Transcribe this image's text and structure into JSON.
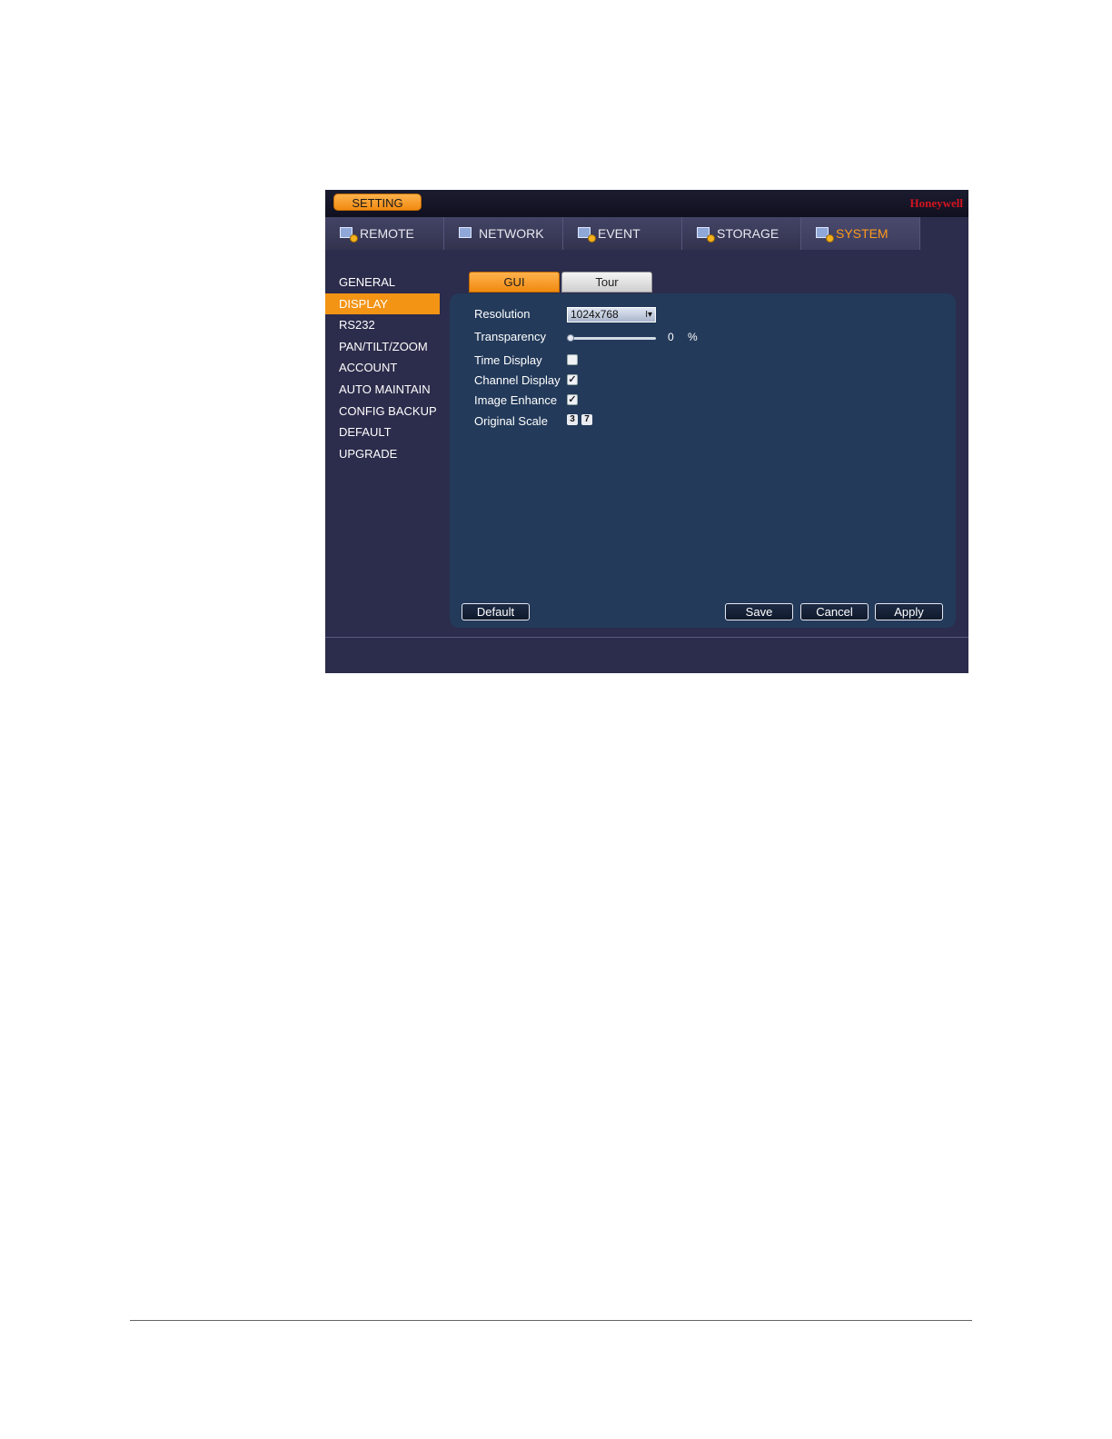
{
  "topbar": {
    "setting_label": "SETTING",
    "brand": "Honeywell"
  },
  "main_tabs": [
    {
      "label": "REMOTE",
      "icon": "remote-settings-icon"
    },
    {
      "label": "NETWORK",
      "icon": "network-icon"
    },
    {
      "label": "EVENT",
      "icon": "event-icon"
    },
    {
      "label": "STORAGE",
      "icon": "storage-icon"
    },
    {
      "label": "SYSTEM",
      "icon": "system-icon",
      "active": true
    }
  ],
  "sidebar": {
    "items": [
      {
        "label": "GENERAL"
      },
      {
        "label": "DISPLAY",
        "active": true
      },
      {
        "label": "RS232"
      },
      {
        "label": "PAN/TILT/ZOOM"
      },
      {
        "label": "ACCOUNT"
      },
      {
        "label": "AUTO MAINTAIN"
      },
      {
        "label": "CONFIG BACKUP"
      },
      {
        "label": "DEFAULT"
      },
      {
        "label": "UPGRADE"
      }
    ]
  },
  "sub_tabs": {
    "gui": "GUI",
    "tour": "Tour"
  },
  "form": {
    "resolution": {
      "label": "Resolution",
      "value": "1024x768"
    },
    "transparency": {
      "label": "Transparency",
      "value": "0",
      "unit": "%",
      "level": 0
    },
    "time_display": {
      "label": "Time Display",
      "checked": false
    },
    "channel_display": {
      "label": "Channel Display",
      "checked": true
    },
    "image_enhance": {
      "label": "Image Enhance",
      "checked": true
    },
    "original_scale": {
      "label": "Original Scale",
      "options": [
        "3",
        "7"
      ]
    }
  },
  "buttons": {
    "default": "Default",
    "save": "Save",
    "cancel": "Cancel",
    "apply": "Apply"
  },
  "colors": {
    "accent": "#f39415",
    "panel": "#233a5a",
    "window": "#2c2c4c",
    "brand": "#d4141e"
  }
}
